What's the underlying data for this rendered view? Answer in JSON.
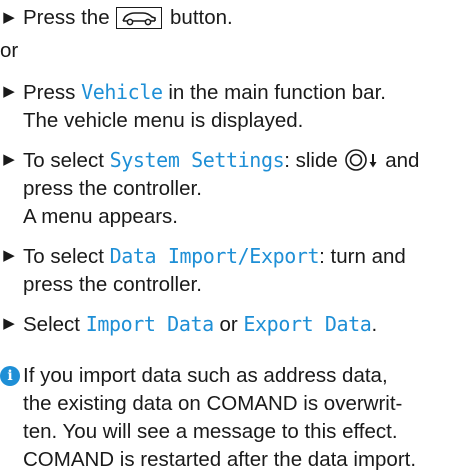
{
  "steps": {
    "s1": {
      "a": "Press the",
      "b": "button."
    },
    "or": "or",
    "s2": {
      "term": "Vehicle",
      "a": "in the main function bar.",
      "b": "The vehicle menu is displayed."
    },
    "s3": {
      "a": "To select",
      "term": "System Settings",
      "b": ": slide",
      "c": "and",
      "d": "press the controller.",
      "e": "A menu appears."
    },
    "s4": {
      "a": "To select",
      "term": "Data Import/Export",
      "b": ": turn and",
      "c": "press the controller."
    },
    "s5": {
      "a": "Select",
      "term1": "Import Data",
      "b": "or",
      "term2": "Export Data",
      "c": "."
    }
  },
  "note": {
    "icon": "info-icon",
    "lines": [
      "If you import data such as address data,",
      "the existing data on COMAND is overwrit-",
      "ten. You will see a message to this effect.",
      "COMAND is restarted after the data import."
    ]
  },
  "colors": {
    "term": "#1e8fd6",
    "text": "#1a1a1a"
  }
}
